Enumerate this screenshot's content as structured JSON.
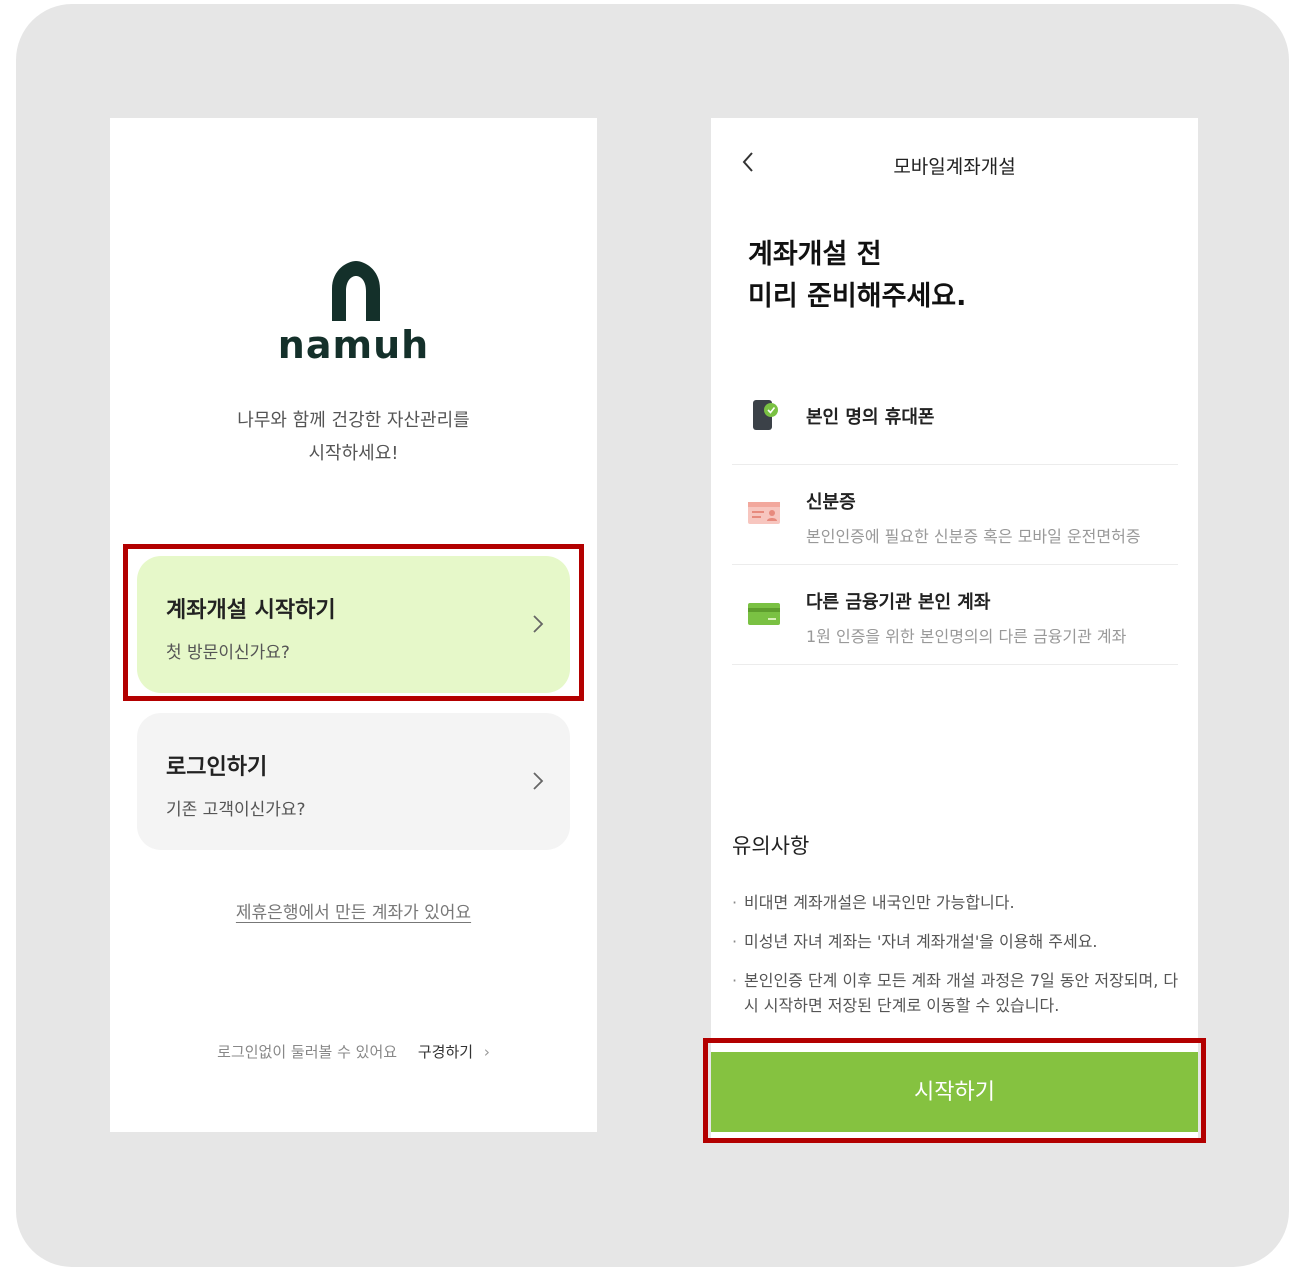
{
  "left_screen": {
    "logo_text": "namuh",
    "tagline_line1": "나무와 함께 건강한 자산관리를",
    "tagline_line2": "시작하세요!",
    "cards": [
      {
        "title": "계좌개설 시작하기",
        "subtitle": "첫 방문이신가요?"
      },
      {
        "title": "로그인하기",
        "subtitle": "기존 고객이신가요?"
      }
    ],
    "partner_link": "제휴은행에서 만든 계좌가 있어요",
    "browse_text": "로그인없이 둘러볼 수 있어요",
    "browse_button": "구경하기",
    "browse_chevron": "›"
  },
  "right_screen": {
    "nav_title": "모바일계좌개설",
    "headline_line1": "계좌개설 전",
    "headline_line2": "미리 준비해주세요.",
    "requirements": [
      {
        "icon": "phone-icon",
        "title": "본인 명의 휴대폰",
        "desc": ""
      },
      {
        "icon": "id-card-icon",
        "title": "신분증",
        "desc": "본인인증에 필요한 신분증 혹은 모바일 운전면허증"
      },
      {
        "icon": "bank-card-icon",
        "title": "다른 금융기관 본인 계좌",
        "desc": "1원 인증을 위한 본인명의의 다른 금융기관 계좌"
      }
    ],
    "notice_title": "유의사항",
    "notices": [
      "비대면 계좌개설은 내국인만 가능합니다.",
      "미성년 자녀 계좌는 '자녀 계좌개설'을 이용해 주세요.",
      "본인인증 단계 이후 모든 계좌 개설 과정은 7일 동안 저장되며, 다시 시작하면 저장된 단계로 이동할 수 있습니다."
    ],
    "start_button": "시작하기"
  },
  "colors": {
    "brand_dark": "#14302a",
    "accent_green": "#85c240",
    "card_green": "#e6f8c9",
    "highlight_red": "#b30000"
  }
}
